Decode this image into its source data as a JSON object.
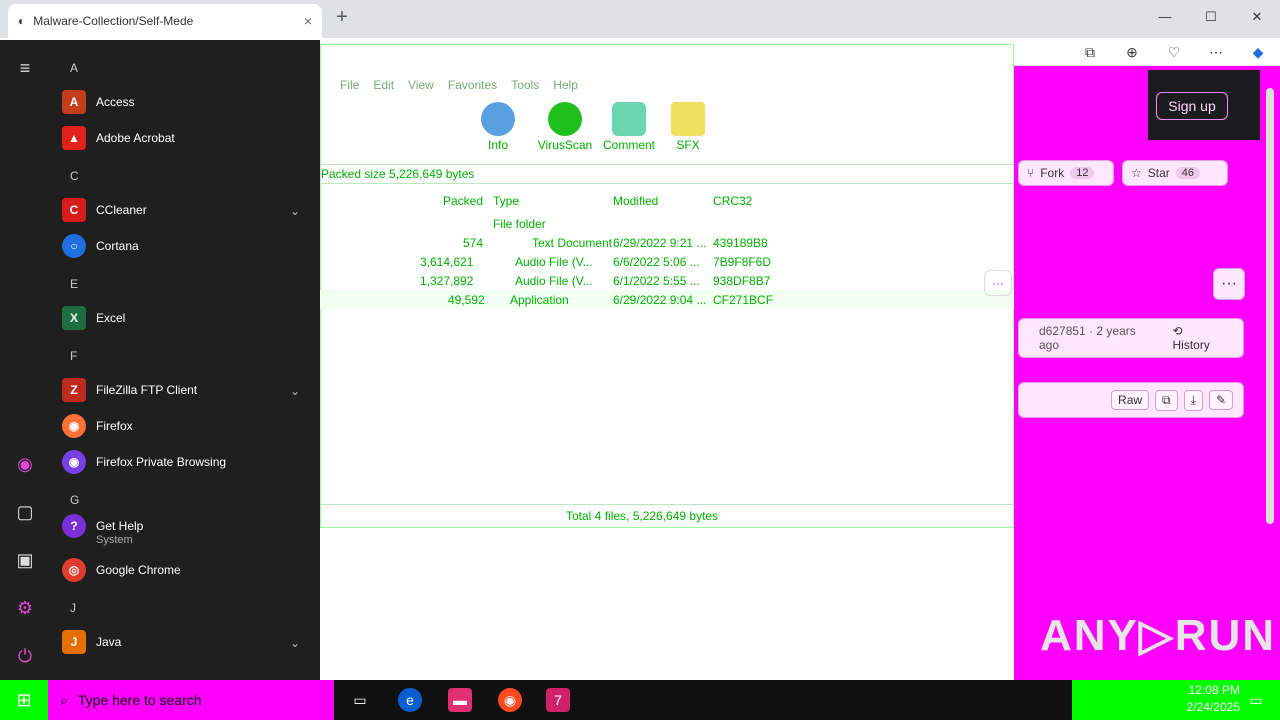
{
  "browser": {
    "tab_title": "Malware-Collection/Self-Mede",
    "tab_close": "×",
    "new_tab": "+",
    "window_controls": [
      "—",
      "☐",
      "✕"
    ],
    "toolbar_icons": [
      "collections-icon",
      "extensions-icon",
      "favorites-icon",
      "more-icon",
      "copilot-icon"
    ]
  },
  "github": {
    "signup": "Sign up",
    "fork_label": "Fork",
    "fork_count": "12",
    "star_label": "Star",
    "star_count": "46",
    "more": "···",
    "commit": "d627851 · 2 years ago",
    "history": "History",
    "raw": "Raw"
  },
  "start_menu": {
    "letters": [
      "A",
      "C",
      "E",
      "F",
      "G",
      "J"
    ],
    "apps": [
      {
        "name": "Access",
        "color": "#c43e1c",
        "glyph": "A"
      },
      {
        "name": "Adobe Acrobat",
        "color": "#e3201b",
        "glyph": "▲"
      },
      {
        "name": "CCleaner",
        "color": "#d81b1b",
        "glyph": "C"
      },
      {
        "name": "Cortana",
        "color": "#1f6fe0",
        "glyph": "○"
      },
      {
        "name": "Excel",
        "color": "#1d6f42",
        "glyph": "X"
      },
      {
        "name": "FileZilla FTP Client",
        "color": "#bf2a1f",
        "glyph": "Z"
      },
      {
        "name": "Firefox",
        "color": "#ff7139",
        "glyph": "◉"
      },
      {
        "name": "Firefox Private Browsing",
        "color": "#7542e5",
        "glyph": "◉"
      },
      {
        "name": "Get Help",
        "color": "#7a2fd8",
        "glyph": "?"
      },
      {
        "name": "Google Chrome",
        "color": "#e33b2e",
        "glyph": "◎"
      },
      {
        "name": "Java",
        "color": "#e76f00",
        "glyph": "J"
      }
    ],
    "get_help_sub": "System"
  },
  "zip": {
    "menu": [
      "File",
      "Edit",
      "View",
      "Favorites",
      "Tools",
      "Help"
    ],
    "tools": [
      {
        "label": "Info",
        "color": "#5aa0e0"
      },
      {
        "label": "VirusScan",
        "color": "#1fbf1f"
      },
      {
        "label": "Comment",
        "color": "#6ad6b0"
      },
      {
        "label": "SFX",
        "color": "#f0e060"
      }
    ],
    "path": "Packed size 5,226,649 bytes",
    "columns": [
      "Packed",
      "Type",
      "Modified",
      "CRC32"
    ],
    "rows": [
      {
        "packed": "",
        "type": "File folder",
        "modified": "",
        "crc": ""
      },
      {
        "packed": "574",
        "type": "Text Document",
        "modified": "6/29/2022 9:21 ...",
        "crc": "439189B8"
      },
      {
        "packed": "3,614,621",
        "type": "Audio File (V...",
        "modified": "6/6/2022 5:06 ...",
        "crc": "7B9F8F6D"
      },
      {
        "packed": "1,327,892",
        "type": "Audio File (V...",
        "modified": "6/1/2022 5:55 ...",
        "crc": "938DF8B7"
      },
      {
        "packed": "49,592",
        "type": "Application",
        "modified": "6/29/2022 9:04 ...",
        "crc": "CF271BCF"
      }
    ],
    "status": "Total 4 files, 5,226,649 bytes",
    "more": "···"
  },
  "taskbar": {
    "search_placeholder": "Type here to search",
    "time": "12:08 PM",
    "date": "2/24/2025"
  },
  "watermark": "ANY▷RUN"
}
